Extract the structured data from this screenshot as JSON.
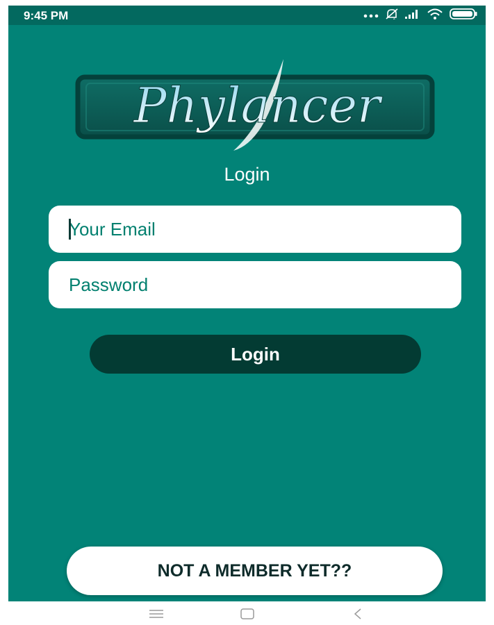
{
  "status_bar": {
    "time": "9:45 PM",
    "icons": [
      "more-dots-icon",
      "muted-notification-icon",
      "signal-icon",
      "wifi-icon",
      "battery-icon"
    ]
  },
  "logo": {
    "text": "Phylancer",
    "icon": "phylancer-logo"
  },
  "login_form": {
    "title": "Login",
    "email": {
      "value": "",
      "placeholder": "Your Email"
    },
    "password": {
      "value": "",
      "placeholder": "Password"
    },
    "submit_label": "Login"
  },
  "signup": {
    "label": "NOT A MEMBER YET??"
  },
  "nav_bar": {
    "icons": [
      "menu-icon",
      "home-icon",
      "back-icon"
    ]
  },
  "colors": {
    "background": "#028377",
    "status_bar": "#03695f",
    "login_button": "#033b33",
    "field_text": "#02806f",
    "field_background": "#ffffff"
  }
}
